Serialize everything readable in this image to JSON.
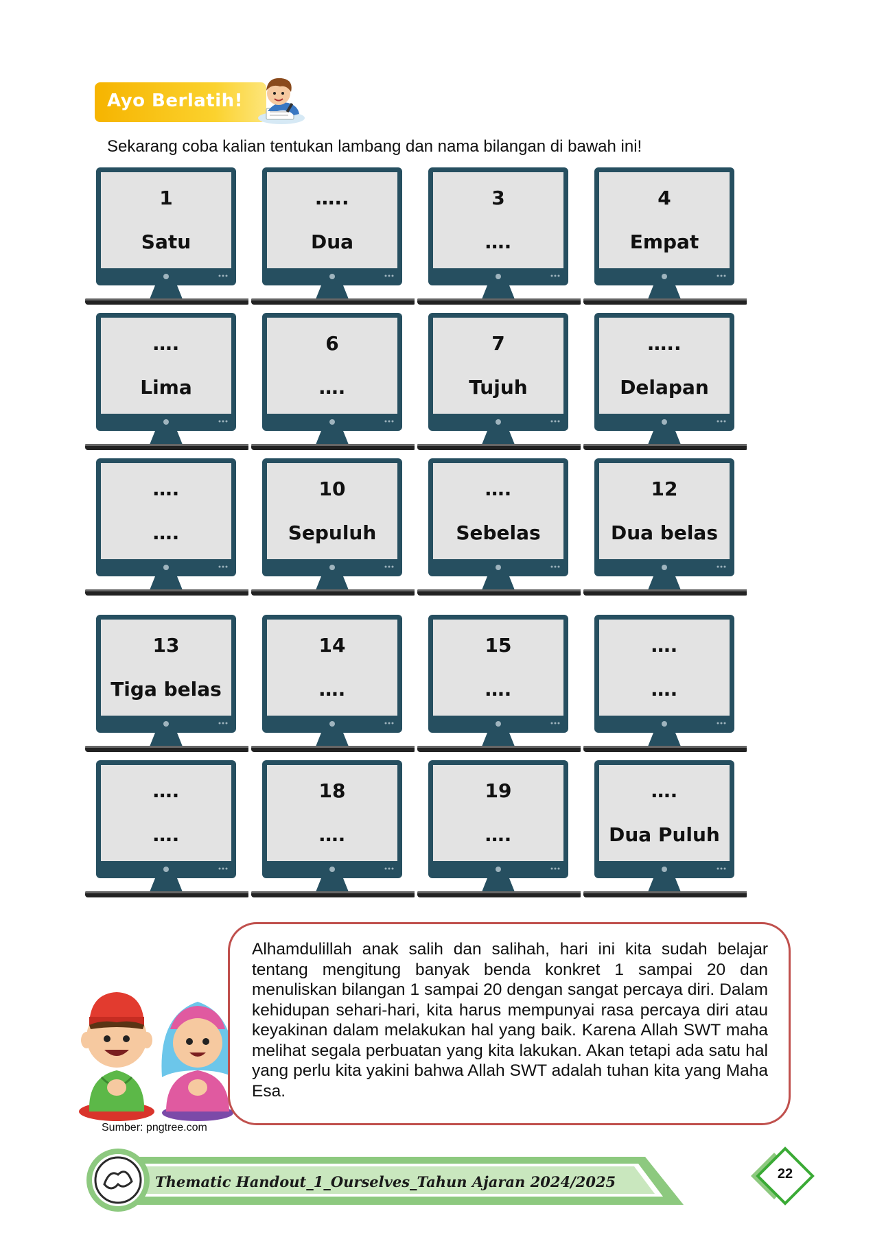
{
  "header": {
    "badge_label": "Ayo Berlatih!",
    "instruction": "Sekarang coba kalian tentukan lambang dan nama bilangan di bawah ini!"
  },
  "monitors": [
    {
      "line1": "1",
      "line2": "Satu"
    },
    {
      "line1": "…..",
      "line2": "Dua"
    },
    {
      "line1": "3",
      "line2": "…."
    },
    {
      "line1": "4",
      "line2": "Empat"
    },
    {
      "line1": "….",
      "line2": "Lima"
    },
    {
      "line1": "6",
      "line2": "…."
    },
    {
      "line1": "7",
      "line2": "Tujuh"
    },
    {
      "line1": "…..",
      "line2": "Delapan"
    },
    {
      "line1": "….",
      "line2": "…."
    },
    {
      "line1": "10",
      "line2": "Sepuluh"
    },
    {
      "line1": "….",
      "line2": "Sebelas"
    },
    {
      "line1": "12",
      "line2": "Dua belas"
    },
    {
      "line1": "13",
      "line2": "Tiga belas"
    },
    {
      "line1": "14",
      "line2": "…."
    },
    {
      "line1": "15",
      "line2": "…."
    },
    {
      "line1": "….",
      "line2": "…."
    },
    {
      "line1": "….",
      "line2": "…."
    },
    {
      "line1": "18",
      "line2": "…."
    },
    {
      "line1": "19",
      "line2": "…."
    },
    {
      "line1": "….",
      "line2": "Dua Puluh"
    }
  ],
  "closing": {
    "text": "Alhamdulillah anak salih dan salihah, hari ini kita sudah belajar tentang mengitung banyak benda konkret 1 sampai 20 dan menuliskan bilangan 1 sampai 20 dengan sangat percaya diri. Dalam kehidupan sehari-hari, kita harus mempunyai rasa percaya diri atau keyakinan dalam melakukan hal yang baik. Karena Allah SWT maha melihat segala perbuatan yang kita lakukan. Akan tetapi ada satu hal yang perlu kita yakini bahwa Allah SWT adalah tuhan kita yang Maha Esa.",
    "source": "Sumber: pngtree.com"
  },
  "footer": {
    "title": "Thematic Handout_1_Ourselves_Tahun Ajaran 2024/2025",
    "page_number": "22",
    "accent_color": "#8dc97f"
  },
  "colors": {
    "monitor_frame": "#264f60",
    "screen": "#e3e3e3",
    "closing_border": "#c0504d",
    "badge": "#f6b400"
  }
}
